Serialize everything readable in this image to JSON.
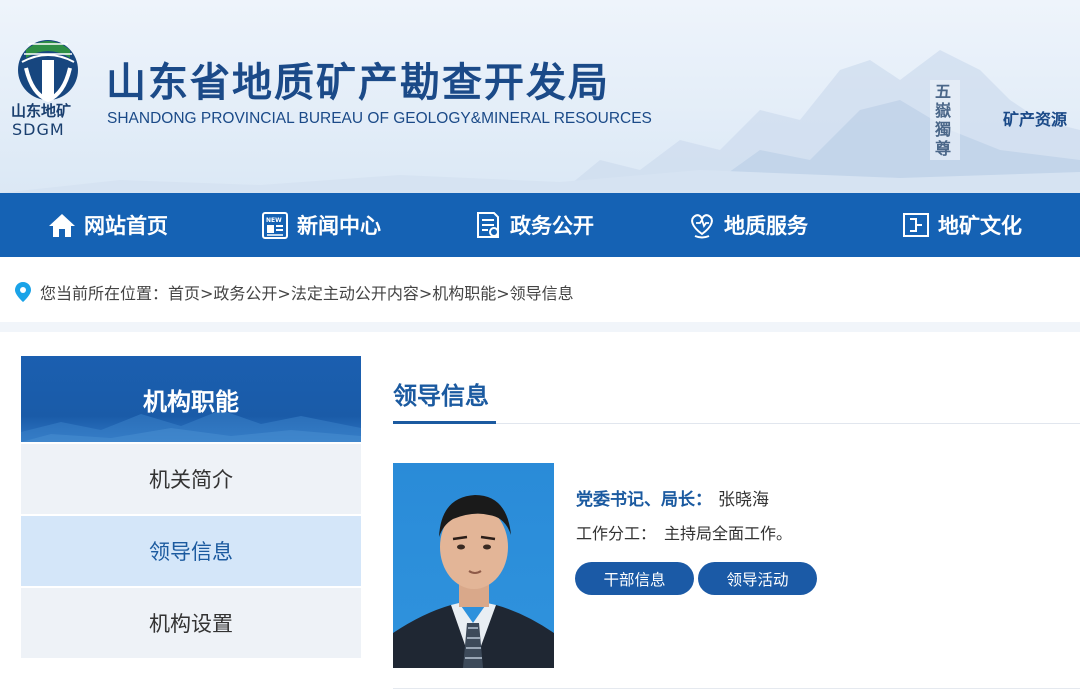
{
  "header": {
    "logo_cn": "山东地矿",
    "logo_en": "SDGM",
    "title": "山东省地质矿产勘查开发局",
    "subtitle": "SHANDONG PROVINCIAL BUREAU OF GEOLOGY&MINERAL RESOURCES",
    "right_text": "矿产资源",
    "stamp_text": "五嶽獨尊"
  },
  "nav": {
    "items": [
      {
        "label": "网站首页",
        "icon": "home-icon"
      },
      {
        "label": "新闻中心",
        "icon": "news-icon"
      },
      {
        "label": "政务公开",
        "icon": "document-icon"
      },
      {
        "label": "地质服务",
        "icon": "heart-hand-icon"
      },
      {
        "label": "地矿文化",
        "icon": "frame-icon"
      }
    ]
  },
  "breadcrumb": {
    "text": "您当前所在位置：首页>政务公开>法定主动公开内容>机构职能>领导信息"
  },
  "sidebar": {
    "title": "机构职能",
    "items": [
      {
        "label": "机关简介",
        "active": false
      },
      {
        "label": "领导信息",
        "active": true
      },
      {
        "label": "机构设置",
        "active": false
      }
    ]
  },
  "main": {
    "title": "领导信息",
    "leader": {
      "role": "党委书记、局长：",
      "name": "张晓海",
      "duty_label": "工作分工：",
      "duty_text": "主持局全面工作。"
    },
    "buttons": {
      "profile": "干部信息",
      "activity": "领导活动"
    }
  },
  "colors": {
    "nav_bg": "#1562b4",
    "accent": "#1b5aa0",
    "sidebar_active_bg": "#d4e6f9",
    "sidebar_item_bg": "#eef2f7"
  }
}
